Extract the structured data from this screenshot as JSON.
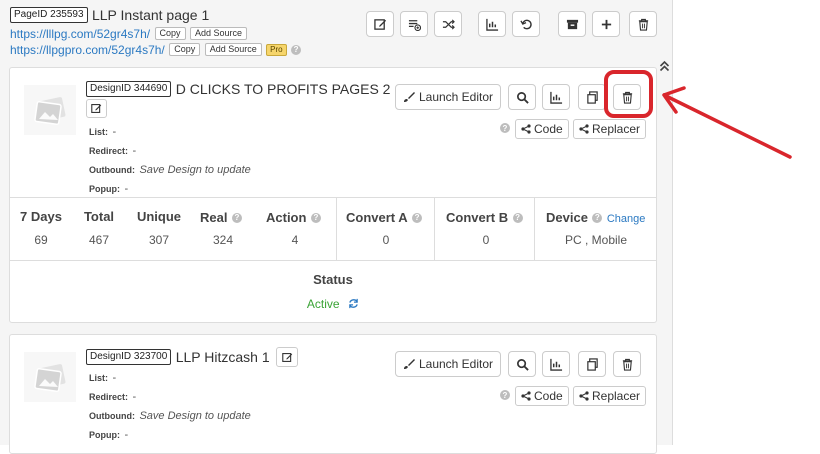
{
  "page": {
    "id_badge": "PageID 235593",
    "title": "LLP Instant page 1",
    "url1": "https://lllpg.com/52gr4s7h/",
    "url2": "https://llpgpro.com/52gr4s7h/",
    "copy_label": "Copy",
    "add_source_label": "Add Source",
    "pro_label": "Pro",
    "toolbar_icons": [
      "edit-icon",
      "playlist-add-icon",
      "shuffle-icon",
      "chart-icon",
      "undo-icon",
      "archive-icon",
      "plus-icon",
      "trash-icon"
    ]
  },
  "designs": [
    {
      "id_badge": "DesignID 344690",
      "title": "D CLICKS TO PROFITS PAGES 2",
      "list_label": "List:",
      "list_value": "-",
      "redirect_label": "Redirect:",
      "redirect_value": "-",
      "outbound_label": "Outbound:",
      "outbound_value": "Save Design to update",
      "popup_label": "Popup:",
      "popup_value": "-",
      "launch_label": "Launch Editor",
      "code_label": "Code",
      "replacer_label": "Replacer",
      "stats": {
        "headers": [
          "7 Days",
          "Total",
          "Unique",
          "Real",
          "Action",
          "Convert A",
          "Convert B",
          "Device"
        ],
        "values": [
          "69",
          "467",
          "307",
          "324",
          "4",
          "0",
          "0",
          "PC , Mobile"
        ],
        "change_label": "Change",
        "status_label": "Status",
        "status_value": "Active"
      }
    },
    {
      "id_badge": "DesignID 323700",
      "title": "LLP Hitzcash 1",
      "list_label": "List:",
      "list_value": "-",
      "redirect_label": "Redirect:",
      "redirect_value": "-",
      "outbound_label": "Outbound:",
      "outbound_value": "Save Design to update",
      "popup_label": "Popup:",
      "popup_value": "-",
      "launch_label": "Launch Editor",
      "code_label": "Code",
      "replacer_label": "Replacer"
    }
  ],
  "colors": {
    "annotation": "#d9262c",
    "active": "#3aa335",
    "link": "#2b79c2"
  }
}
